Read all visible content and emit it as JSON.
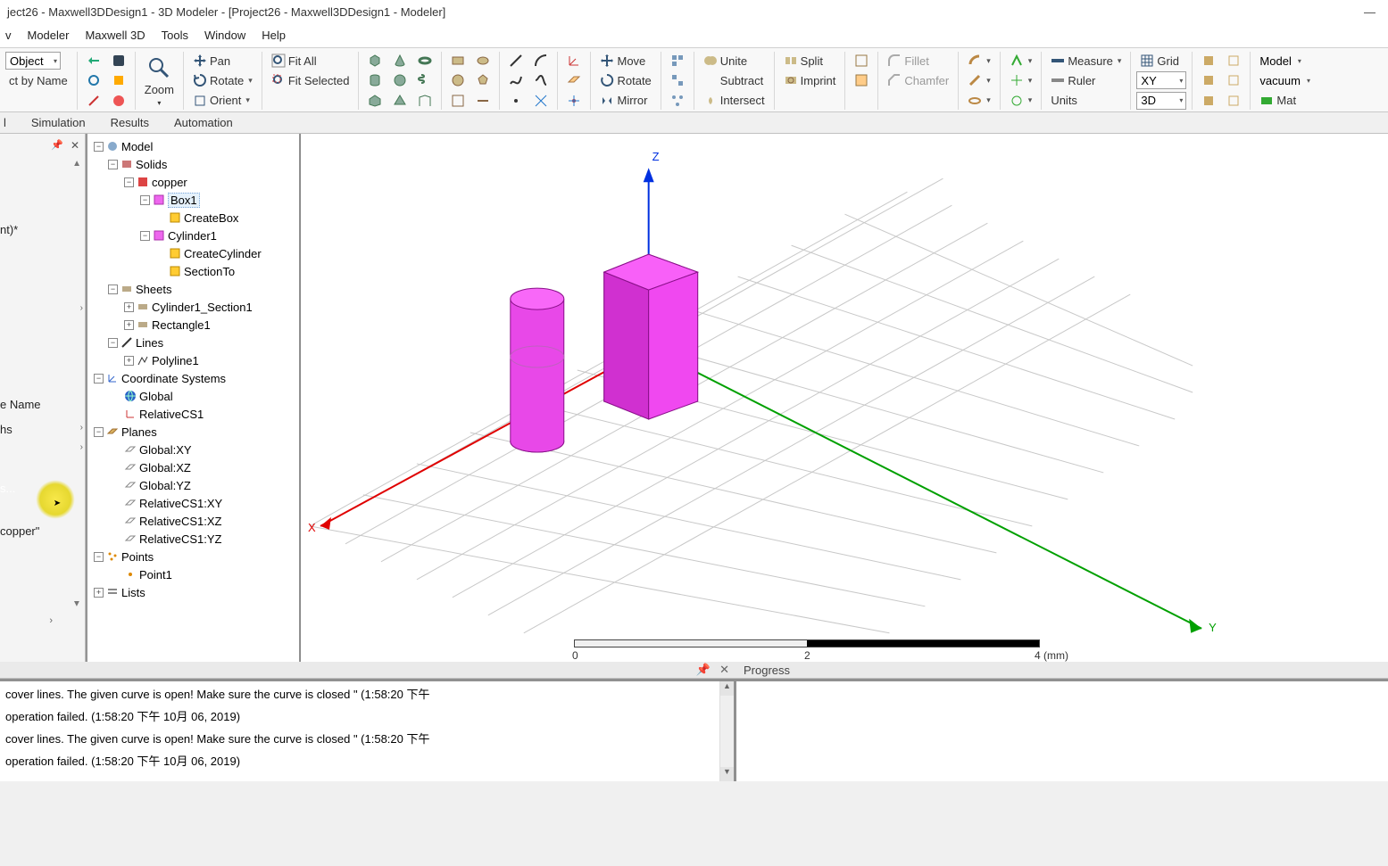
{
  "title": "ject26 - Maxwell3DDesign1 - 3D Modeler - [Project26 - Maxwell3DDesign1 - Modeler]",
  "menus": [
    "v",
    "Modeler",
    "Maxwell 3D",
    "Tools",
    "Window",
    "Help"
  ],
  "toolbar": {
    "selObject": "Object",
    "selByName": "ct by Name",
    "zoom": "Zoom",
    "pan": "Pan",
    "rotate": "Rotate",
    "orient": "Orient",
    "fitAll": "Fit All",
    "fitSel": "Fit Selected",
    "move": "Move",
    "rotateOp": "Rotate",
    "mirror": "Mirror",
    "unite": "Unite",
    "subtract": "Subtract",
    "intersect": "Intersect",
    "split": "Split",
    "imprint": "Imprint",
    "fillet": "Fillet",
    "chamfer": "Chamfer",
    "measure": "Measure",
    "grid": "Grid",
    "ruler": "Ruler",
    "units": "Units",
    "plane": "XY",
    "mode3d": "3D",
    "modelSel": "Model",
    "vacuum": "vacuum",
    "mat": "Mat"
  },
  "tabs": {
    "a": "l",
    "b": "Simulation",
    "c": "Results",
    "d": "Automation"
  },
  "leftstrip": {
    "frag1": "nt)*",
    "frag2": "e Name",
    "frag3": "hs",
    "frag4": "s...",
    "frag5": "copper\""
  },
  "tree": {
    "model": "Model",
    "solids": "Solids",
    "copper": "copper",
    "box1": "Box1",
    "createBox": "CreateBox",
    "cyl1": "Cylinder1",
    "createCyl": "CreateCylinder",
    "sectionTo": "SectionTo",
    "sheets": "Sheets",
    "cylSection": "Cylinder1_Section1",
    "rect1": "Rectangle1",
    "lines": "Lines",
    "polyline1": "Polyline1",
    "coord": "Coordinate Systems",
    "global": "Global",
    "relCS1": "RelativeCS1",
    "planes": "Planes",
    "gXY": "Global:XY",
    "gXZ": "Global:XZ",
    "gYZ": "Global:YZ",
    "rXY": "RelativeCS1:XY",
    "rXZ": "RelativeCS1:XZ",
    "rYZ": "RelativeCS1:YZ",
    "points": "Points",
    "point1": "Point1",
    "lists": "Lists"
  },
  "viewport": {
    "axisX": "X",
    "axisY": "Y",
    "axisZ": "Z",
    "scale0": "0",
    "scale2": "2",
    "scale4": "4 (mm)"
  },
  "progress": {
    "title": "Progress"
  },
  "msgs": {
    "m1": "cover lines. The given curve is open! Make sure the curve is closed \" (1:58:20 下午",
    "m2": "operation failed. (1:58:20 下午  10月 06, 2019)",
    "m3": "cover lines. The given curve is open! Make sure the curve is closed \" (1:58:20 下午",
    "m4": "operation failed. (1:58:20 下午  10月 06, 2019)"
  }
}
